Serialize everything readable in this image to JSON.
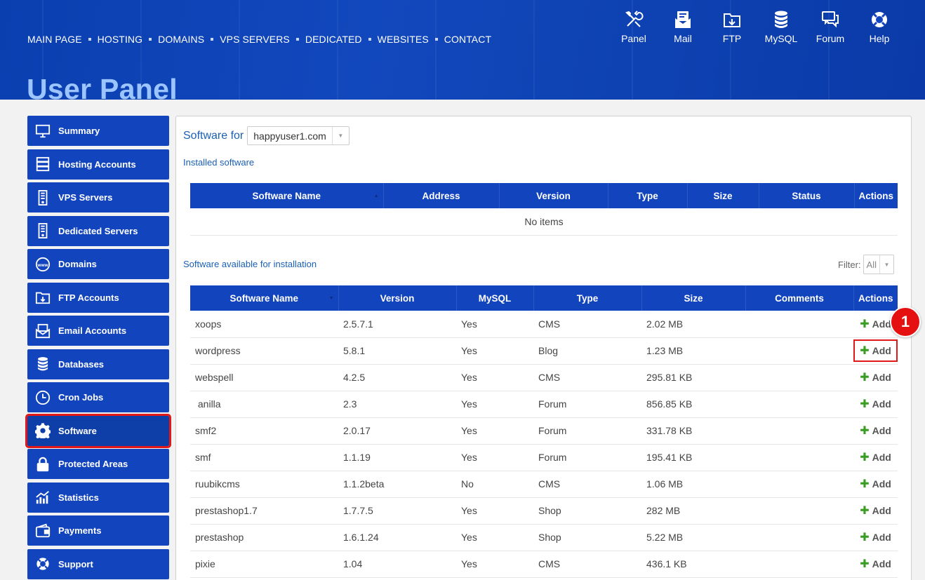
{
  "topnav": [
    "MAIN PAGE",
    "HOSTING",
    "DOMAINS",
    "VPS SERVERS",
    "DEDICATED",
    "WEBSITES",
    "CONTACT"
  ],
  "tools": [
    {
      "label": "Panel",
      "icon": "tools-icon"
    },
    {
      "label": "Mail",
      "icon": "mail-icon"
    },
    {
      "label": "FTP",
      "icon": "ftp-folder-icon"
    },
    {
      "label": "MySQL",
      "icon": "database-icon"
    },
    {
      "label": "Forum",
      "icon": "forum-icon"
    },
    {
      "label": "Help",
      "icon": "lifebuoy-icon"
    }
  ],
  "page_title": "User Panel",
  "sidebar": [
    {
      "label": "Summary",
      "icon": "monitor-icon"
    },
    {
      "label": "Hosting Accounts",
      "icon": "server-icon"
    },
    {
      "label": "VPS Servers",
      "icon": "vps-icon"
    },
    {
      "label": "Dedicated Servers",
      "icon": "dedicated-icon"
    },
    {
      "label": "Domains",
      "icon": "www-icon"
    },
    {
      "label": "FTP Accounts",
      "icon": "ftp-icon"
    },
    {
      "label": "Email Accounts",
      "icon": "email-icon"
    },
    {
      "label": "Databases",
      "icon": "database-icon"
    },
    {
      "label": "Cron Jobs",
      "icon": "clock-icon"
    },
    {
      "label": "Software",
      "icon": "gear-icon",
      "active": true
    },
    {
      "label": "Protected Areas",
      "icon": "lock-icon"
    },
    {
      "label": "Statistics",
      "icon": "chart-icon"
    },
    {
      "label": "Payments",
      "icon": "wallet-icon"
    },
    {
      "label": "Support",
      "icon": "lifebuoy-icon"
    }
  ],
  "software_for": {
    "label": "Software for",
    "domain": "happyuser1.com"
  },
  "installed": {
    "title": "Installed software",
    "columns": [
      "Software Name",
      "Address",
      "Version",
      "Type",
      "Size",
      "Status",
      "Actions"
    ],
    "empty_text": "No items"
  },
  "available": {
    "title": "Software available for installation",
    "filter_label": "Filter:",
    "filter_value": "All",
    "columns": [
      "Software Name",
      "Version",
      "MySQL",
      "Type",
      "Size",
      "Comments",
      "Actions"
    ],
    "add_label": "Add",
    "rows": [
      {
        "name": "xoops",
        "version": "2.5.7.1",
        "mysql": "Yes",
        "type": "CMS",
        "size": "2.02 MB"
      },
      {
        "name": "wordpress",
        "version": "5.8.1",
        "mysql": "Yes",
        "type": "Blog",
        "size": "1.23 MB"
      },
      {
        "name": "webspell",
        "version": "4.2.5",
        "mysql": "Yes",
        "type": "CMS",
        "size": "295.81 KB"
      },
      {
        "name": " anilla",
        "version": "2.3",
        "mysql": "Yes",
        "type": "Forum",
        "size": "856.85 KB"
      },
      {
        "name": "smf2",
        "version": "2.0.17",
        "mysql": "Yes",
        "type": "Forum",
        "size": "331.78 KB"
      },
      {
        "name": "smf",
        "version": "1.1.19",
        "mysql": "Yes",
        "type": "Forum",
        "size": "195.41 KB"
      },
      {
        "name": "ruubikcms",
        "version": "1.1.2beta",
        "mysql": "No",
        "type": "CMS",
        "size": "1.06 MB"
      },
      {
        "name": "prestashop1.7",
        "version": "1.7.7.5",
        "mysql": "Yes",
        "type": "Shop",
        "size": "282 MB"
      },
      {
        "name": "prestashop",
        "version": "1.6.1.24",
        "mysql": "Yes",
        "type": "Shop",
        "size": "5.22 MB"
      },
      {
        "name": "pixie",
        "version": "1.04",
        "mysql": "Yes",
        "type": "CMS",
        "size": "436.1 KB"
      }
    ]
  },
  "badge": "1"
}
